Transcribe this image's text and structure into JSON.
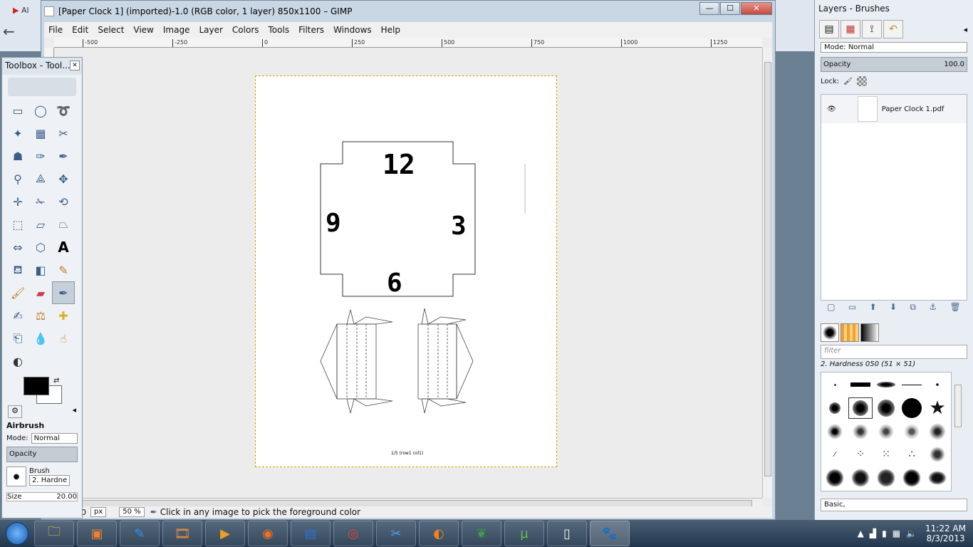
{
  "window": {
    "title": "[Paper Clock 1] (imported)-1.0 (RGB color, 1 layer) 850x1100 – GIMP",
    "min": "—",
    "max": "☐",
    "close": "✕"
  },
  "menu": [
    "File",
    "Edit",
    "Select",
    "View",
    "Image",
    "Layer",
    "Colors",
    "Tools",
    "Filters",
    "Windows",
    "Help"
  ],
  "ruler_ticks": [
    "-500",
    "-250",
    "0",
    "250",
    "500",
    "750",
    "1000",
    "1250"
  ],
  "page": {
    "clock_numbers": {
      "top": "12",
      "left": "9",
      "right": "3",
      "bottom": "6"
    },
    "footer": "1/5 (row1 col1)"
  },
  "status": {
    "coord": "0",
    "unit": "px",
    "zoom": "50 %",
    "message": "Click in any image to pick the foreground color"
  },
  "toolbox": {
    "title": "Toolbox - Tool...",
    "tool_name": "Airbrush",
    "mode_label": "Mode:",
    "mode_value": "Normal",
    "opacity_label": "Opacity",
    "brush_label": "Brush",
    "brush_value": "2. Hardne",
    "size_label": "Size",
    "size_value": "20.00"
  },
  "dock": {
    "title": "Layers - Brushes",
    "mode_label": "Mode:",
    "mode_value": "Normal",
    "opacity_label": "Opacity",
    "opacity_value": "100.0",
    "lock_label": "Lock:",
    "layer_name": "Paper Clock 1.pdf",
    "brush_filter": "filter",
    "brush_selected": "2. Hardness 050 (51 × 51)",
    "brush_tags": "Basic,"
  },
  "tray": {
    "time": "11:22 AM",
    "date": "8/3/2013"
  },
  "background_tabs": [
    "Al"
  ]
}
